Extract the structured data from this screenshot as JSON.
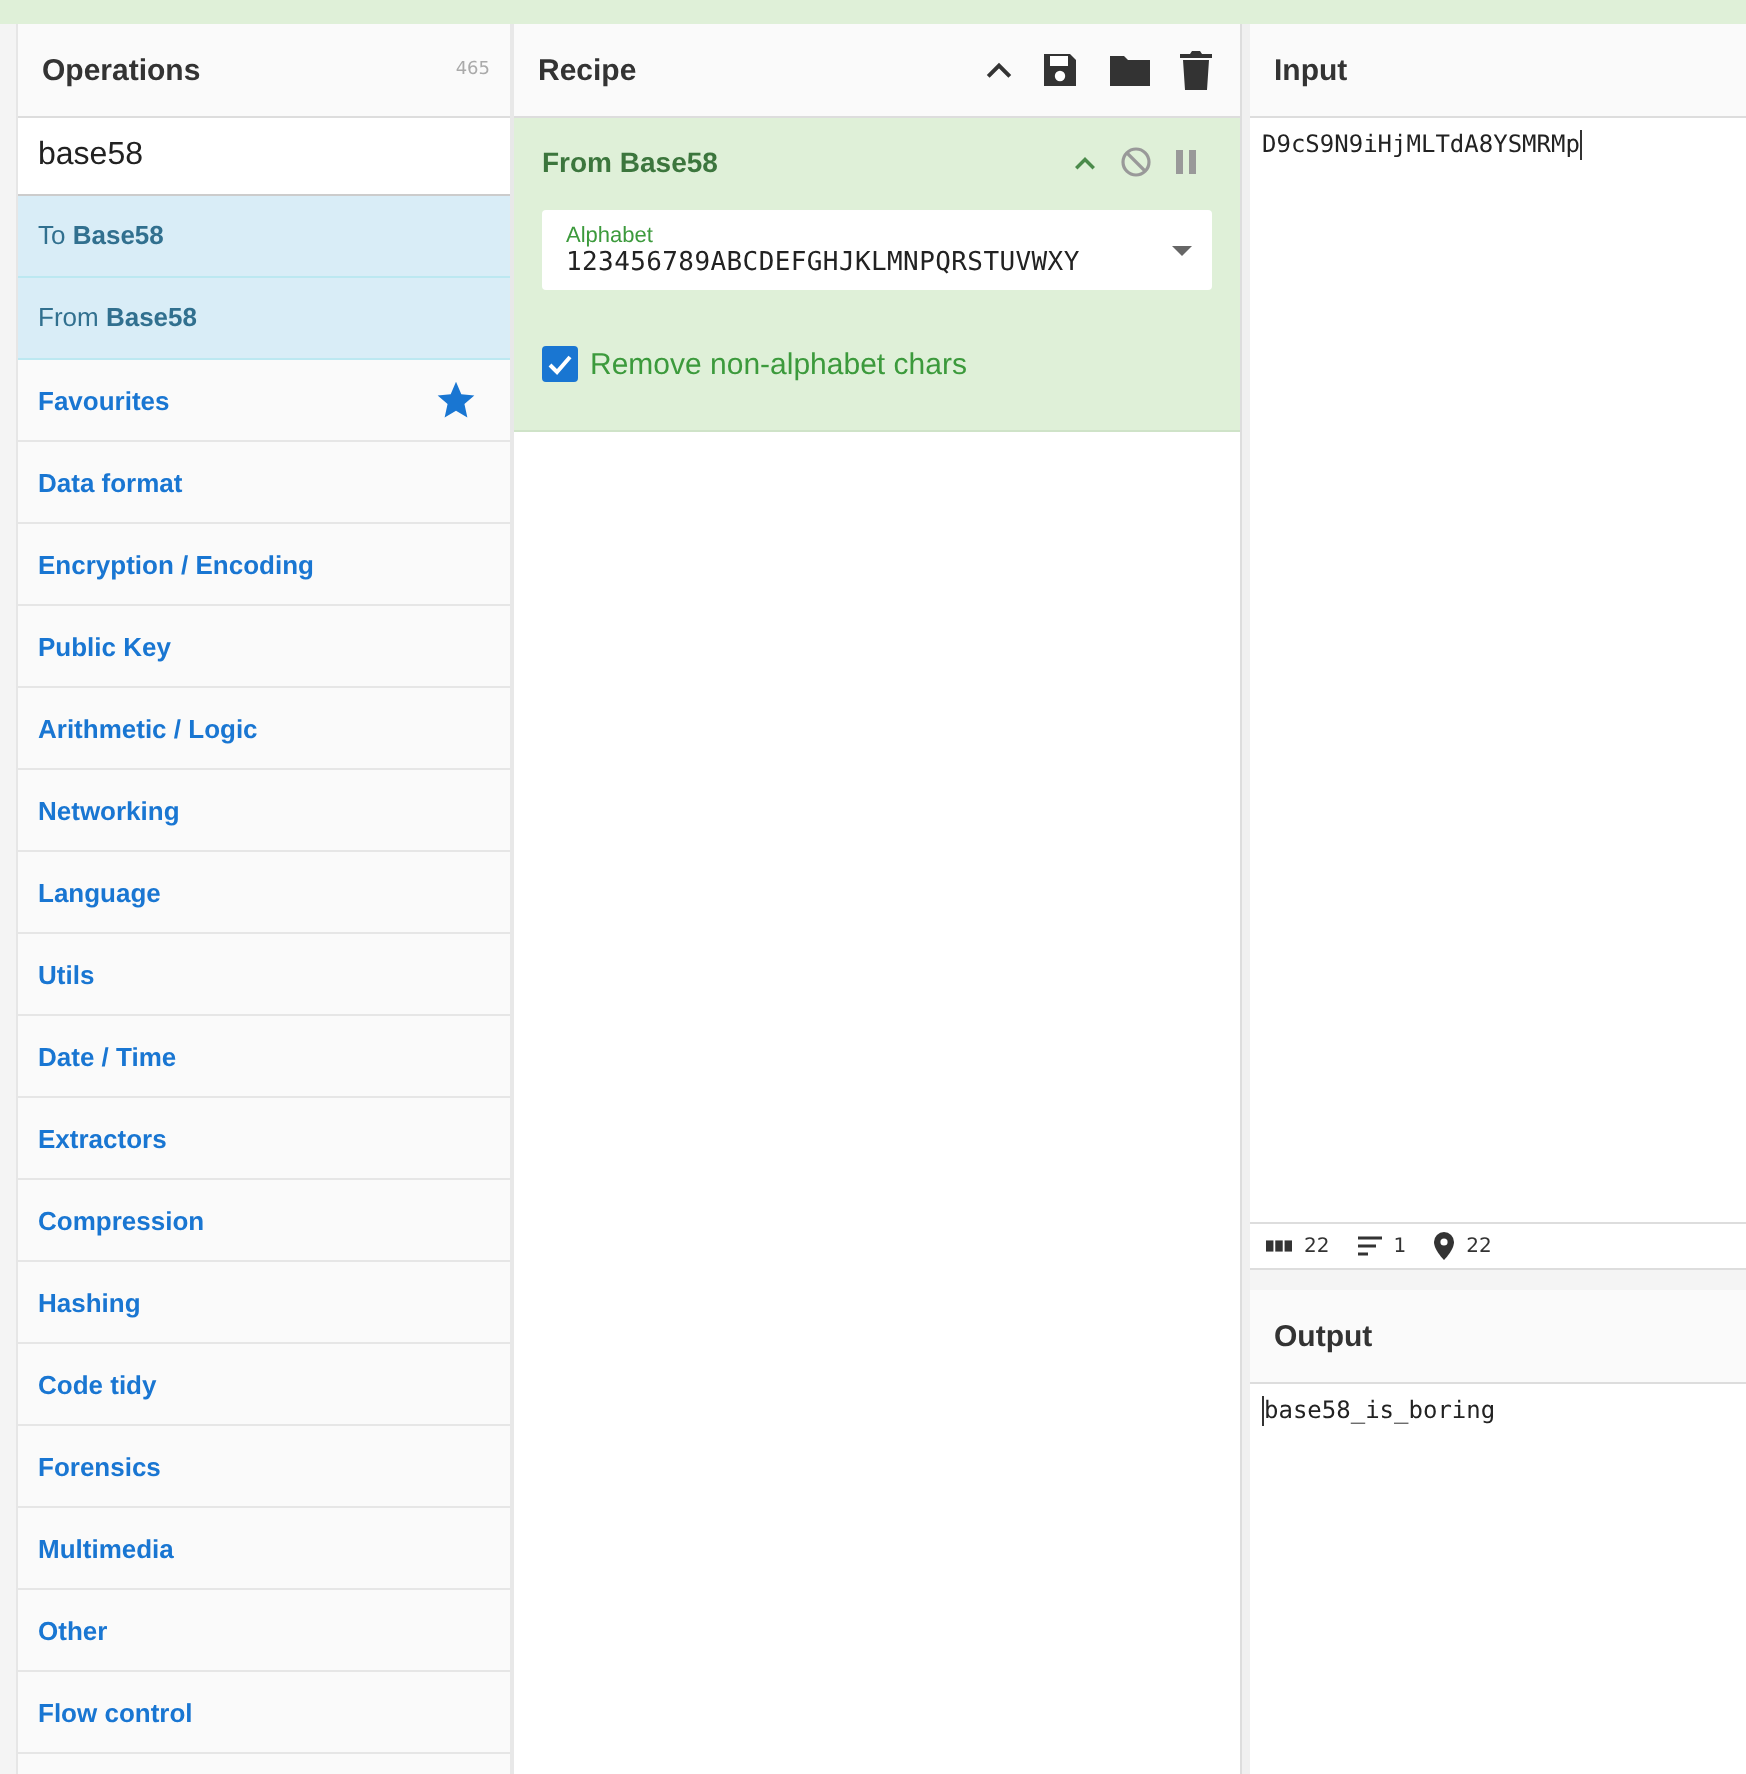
{
  "operations": {
    "title": "Operations",
    "count": "465",
    "search": {
      "value": "base58"
    },
    "results": [
      {
        "text": "To **Base58**"
      },
      {
        "text": "From **Base58**"
      }
    ],
    "categories": [
      {
        "label": "Favourites",
        "kind": "favourites"
      },
      {
        "label": "Data format",
        "kind": "category"
      },
      {
        "label": "Encryption / Encoding",
        "kind": "category"
      },
      {
        "label": "Public Key",
        "kind": "category"
      },
      {
        "label": "Arithmetic / Logic",
        "kind": "category"
      },
      {
        "label": "Networking",
        "kind": "category"
      },
      {
        "label": "Language",
        "kind": "category"
      },
      {
        "label": "Utils",
        "kind": "category"
      },
      {
        "label": "Date / Time",
        "kind": "category"
      },
      {
        "label": "Extractors",
        "kind": "category"
      },
      {
        "label": "Compression",
        "kind": "category"
      },
      {
        "label": "Hashing",
        "kind": "category"
      },
      {
        "label": "Code tidy",
        "kind": "category"
      },
      {
        "label": "Forensics",
        "kind": "category"
      },
      {
        "label": "Multimedia",
        "kind": "category"
      },
      {
        "label": "Other",
        "kind": "category"
      },
      {
        "label": "Flow control",
        "kind": "category"
      }
    ]
  },
  "recipe": {
    "title": "Recipe",
    "operation": {
      "name": "From Base58",
      "alphabet": {
        "label": "Alphabet",
        "value": "123456789ABCDEFGHJKLMNPQRSTUVWXY"
      },
      "remove_non_alphabet": {
        "label": "Remove non-alphabet chars",
        "checked": true
      }
    }
  },
  "input": {
    "title": "Input",
    "value": "D9cS9N9iHjMLTdA8YSMRMp",
    "status": [
      {
        "kind": "length",
        "value": "22"
      },
      {
        "kind": "lines",
        "value": "1"
      },
      {
        "kind": "position",
        "value": "22"
      }
    ]
  },
  "output": {
    "title": "Output",
    "value": "base58_is_boring"
  }
}
